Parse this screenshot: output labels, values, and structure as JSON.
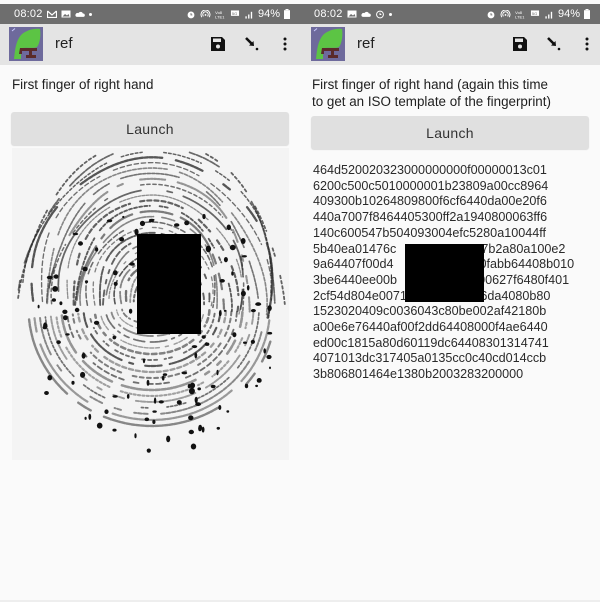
{
  "screens": [
    {
      "status_bar": {
        "time": "08:02",
        "left_icons": [
          "gmail-icon",
          "gallery-icon",
          "cloud-icon",
          "dot-icon"
        ],
        "right_icons": [
          "alarm-icon",
          "hotspot-icon",
          "volte-icon",
          "data-icon",
          "signal-icon"
        ],
        "battery": "94%"
      },
      "app_bar": {
        "title": "ref",
        "actions": [
          "save-icon",
          "import-icon",
          "more-vert-icon"
        ]
      },
      "label": "First finger of right hand",
      "launch_label": "Launch",
      "result_type": "fingerprint-image"
    },
    {
      "status_bar": {
        "time": "08:02",
        "left_icons": [
          "gallery-icon",
          "cloud-icon",
          "history-icon",
          "dot-icon"
        ],
        "right_icons": [
          "alarm-icon",
          "hotspot-icon",
          "volte-icon",
          "data-icon",
          "signal-icon"
        ],
        "battery": "94%"
      },
      "app_bar": {
        "title": "ref",
        "actions": [
          "save-icon",
          "import-icon",
          "more-vert-icon"
        ]
      },
      "label_lines": [
        "First finger of right hand (again this time",
        "to get an ISO template of the fingerprint)"
      ],
      "launch_label": "Launch",
      "result_type": "iso-template-hex",
      "hex_lines": [
        "464d520020323000000000f00000013c01",
        "6200c500c5010000001b23809a00cc8964",
        "409300b10264809800f6cf6440da00e20f6",
        "440a7007f8464405300ff2a1940800063ff6",
        "140c600547b504093004efc5280a10044ff",
        "5b40ea01476c",
        "9a64407f00d4",
        "3be6440ee00b",
        "2cf54d804e0071923840f00136da4080b80",
        "1523020409c0036043c80be002af42180b",
        "a00e6e76440af00f2dd64408000f4ae6440",
        "ed00c1815a80d60119dc64408301314741",
        "4071013dc317405a0135cc0c40cd014ccb",
        "3b806801464e1380b2003283200000"
      ],
      "hex_line_tails": {
        "5": "47b2a80a100e2",
        "6": "0fabb64408b010",
        "7": "00627f6480f401"
      }
    }
  ],
  "colors": {
    "status_bar_bg": "#6e6e6e",
    "app_bar_bg": "#e4e4e4",
    "page_bg": "#fafafa",
    "button_bg": "#e0e0e0",
    "icon_green": "#5cc444",
    "icon_purple": "#6e6a9c",
    "icon_maroon": "#5a2a2a",
    "redaction": "#000000"
  }
}
